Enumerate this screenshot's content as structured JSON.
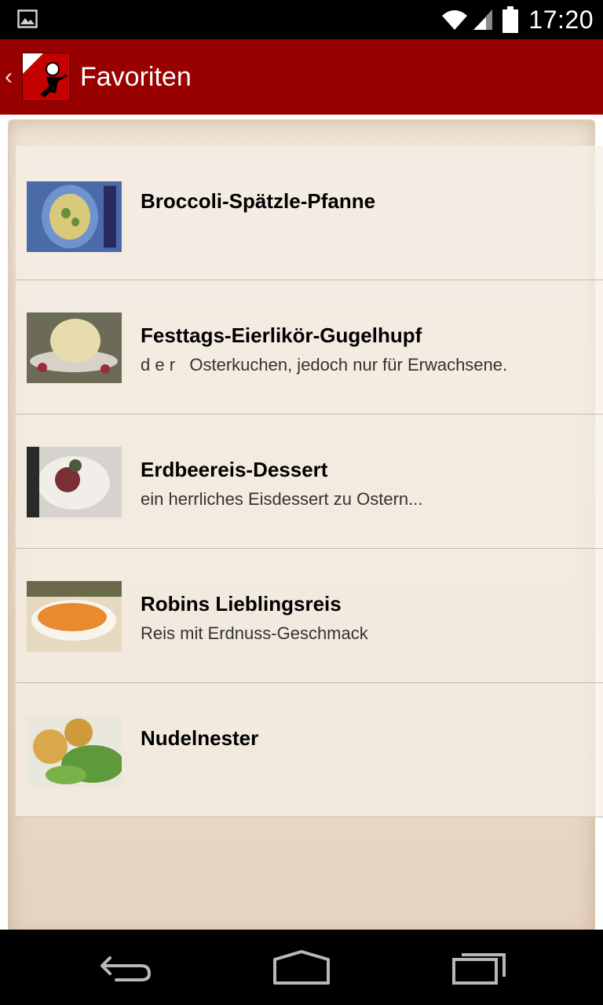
{
  "status_bar": {
    "time": "17:20"
  },
  "action_bar": {
    "title": "Favoriten",
    "logo_icon": "chef-logo-lite",
    "up_icon": "chevron-left-icon",
    "background_color": "#990000"
  },
  "favorites": [
    {
      "title": "Broccoli-Spätzle-Pfanne",
      "subtitle": ""
    },
    {
      "title": "Festtags-Eierlikör-Gugelhupf",
      "subtitle": "d e r   Osterkuchen, jedoch nur für Erwachsene."
    },
    {
      "title": "Erdbeereis-Dessert",
      "subtitle": "ein herrliches Eisdessert zu Ostern..."
    },
    {
      "title": "Robins Lieblingsreis",
      "subtitle": "Reis mit Erdnuss-Geschmack"
    },
    {
      "title": "Nudelnester",
      "subtitle": ""
    }
  ],
  "nav_bar": {
    "back_icon": "back-icon",
    "home_icon": "home-icon",
    "recents_icon": "recent-apps-icon"
  }
}
